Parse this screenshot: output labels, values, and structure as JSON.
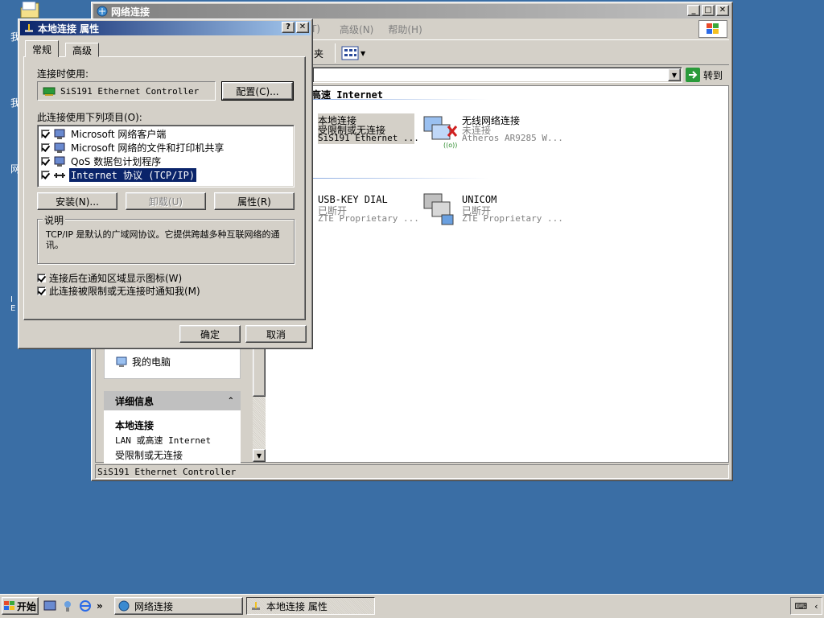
{
  "desktop": {
    "icon_letters": [
      "我",
      "我",
      "网",
      "I",
      "E"
    ]
  },
  "explorer": {
    "title": "网络连接",
    "menu": [
      "高级(N)",
      "帮助(H)"
    ],
    "menu_fragment": "T)",
    "toolbar_folders_fragment": "夹",
    "go_label": "转到",
    "section_header_fragment": "高速 Internet",
    "items": [
      {
        "name": "本地连接",
        "status": "受限制或无连接",
        "device": "SiS191 Ethernet ..."
      },
      {
        "name": "无线网络连接",
        "status": "未连接",
        "device": "Atheros AR9285 W..."
      },
      {
        "name": "USB-KEY DIAL",
        "status": "已断开",
        "device": "ZTE Proprietary ..."
      },
      {
        "name": "UNICOM",
        "status": "已断开",
        "device": "ZTE Proprietary ..."
      }
    ],
    "left_pane": {
      "my_computer": "我的电脑",
      "details_title": "详细信息",
      "details_name": "本地连接",
      "details_type": "LAN 或高速 Internet",
      "details_status": "受限制或无连接"
    },
    "status_text": "SiS191 Ethernet Controller"
  },
  "dialog": {
    "title": "本地连接 属性",
    "tabs": [
      "常规",
      "高级"
    ],
    "connect_using_label": "连接时使用:",
    "adapter_name": "SiS191 Ethernet Controller",
    "configure_btn": "配置(C)...",
    "items_label": "此连接使用下列项目(O):",
    "components": [
      {
        "label": "Microsoft 网络客户端",
        "checked": true
      },
      {
        "label": "Microsoft 网络的文件和打印机共享",
        "checked": true
      },
      {
        "label": "QoS 数据包计划程序",
        "checked": true
      },
      {
        "label": "Internet 协议 (TCP/IP)",
        "checked": true
      }
    ],
    "install_btn": "安装(N)...",
    "uninstall_btn": "卸载(U)",
    "properties_btn": "属性(R)",
    "description_label": "说明",
    "description_text": "TCP/IP 是默认的广域网协议。它提供跨越多种互联网络的通讯。",
    "notify_icon_label": "连接后在通知区域显示图标(W)",
    "notify_limited_label": "此连接被限制或无连接时通知我(M)",
    "ok_btn": "确定",
    "cancel_btn": "取消"
  },
  "taskbar": {
    "start_label": "开始",
    "tasks": [
      "网络连接",
      "本地连接 属性"
    ],
    "more_glyph": "»"
  },
  "colors": {
    "desktop": "#3a6ea5",
    "title_active": "#0a246a",
    "face": "#d4d0c8"
  }
}
